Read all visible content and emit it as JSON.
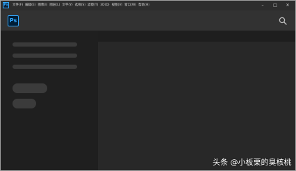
{
  "app": {
    "icon_name": "photoshop-icon",
    "logo_text": "Ps",
    "accent_color": "#31a8ff"
  },
  "menu": {
    "items": [
      {
        "label": "文件(F)"
      },
      {
        "label": "编辑(E)"
      },
      {
        "label": "图像(I)"
      },
      {
        "label": "图层(L)"
      },
      {
        "label": "文字(Y)"
      },
      {
        "label": "选择(S)"
      },
      {
        "label": "滤镜(T)"
      },
      {
        "label": "3D(D)"
      },
      {
        "label": "视图(V)"
      },
      {
        "label": "窗口(W)"
      },
      {
        "label": "帮助(H)"
      }
    ]
  },
  "window_controls": {
    "minimize": "–",
    "maximize": "□",
    "close": "✕"
  },
  "topbar": {
    "search_icon": "search-icon"
  },
  "watermark": {
    "text": "头条 @小板栗的臭核桃"
  }
}
